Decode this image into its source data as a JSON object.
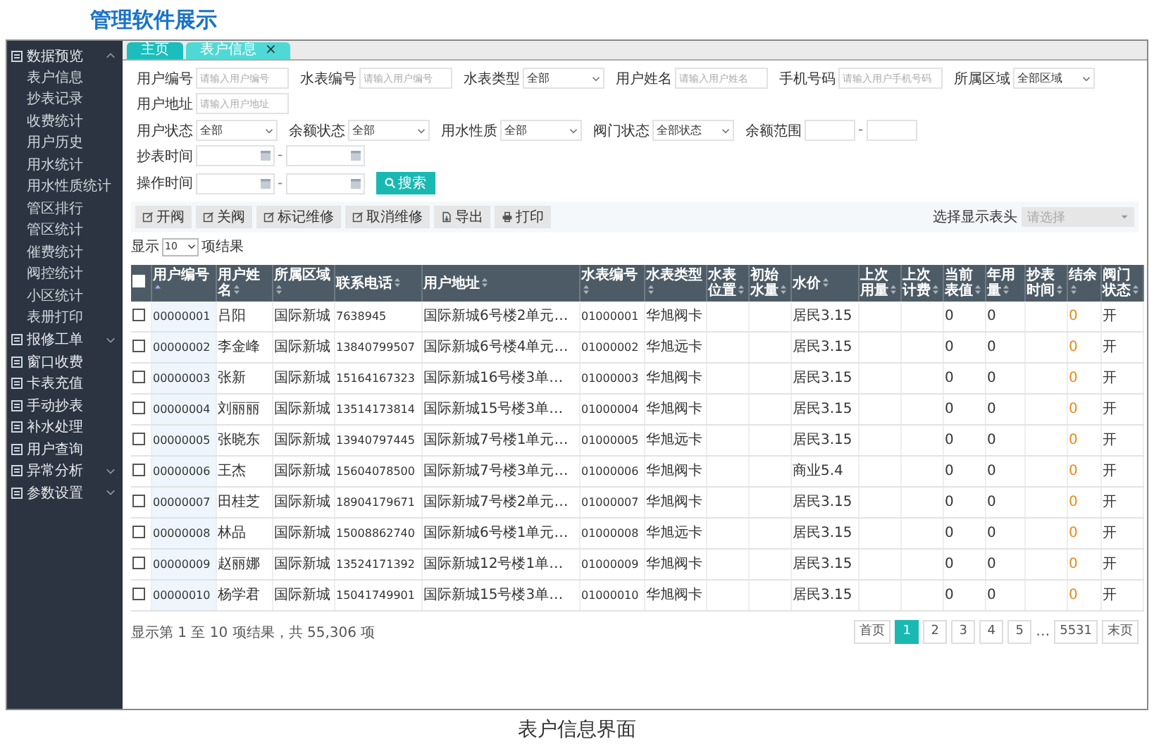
{
  "page": {
    "title": "管理软件展示",
    "caption": "表户信息界面"
  },
  "sidebar": {
    "items": [
      {
        "label": "数据预览",
        "expanded": true,
        "children": [
          {
            "label": "表户信息"
          },
          {
            "label": "抄表记录"
          },
          {
            "label": "收费统计"
          },
          {
            "label": "用户历史"
          },
          {
            "label": "用水统计"
          },
          {
            "label": "用水性质统计"
          },
          {
            "label": "管区排行"
          },
          {
            "label": "管区统计"
          },
          {
            "label": "催费统计"
          },
          {
            "label": "阀控统计"
          },
          {
            "label": "小区统计"
          },
          {
            "label": "表册打印"
          }
        ]
      },
      {
        "label": "报修工单",
        "expanded": false
      },
      {
        "label": "窗口收费"
      },
      {
        "label": "卡表充值"
      },
      {
        "label": "手动抄表"
      },
      {
        "label": "补水处理"
      },
      {
        "label": "用户查询"
      },
      {
        "label": "异常分析",
        "expanded": false
      },
      {
        "label": "参数设置",
        "expanded": false
      }
    ]
  },
  "tabs": [
    {
      "label": "主页",
      "selected": false
    },
    {
      "label": "表户信息",
      "selected": true,
      "close": "×"
    }
  ],
  "filter_rows": [
    [
      {
        "label": "用户编号",
        "kind": "text",
        "placeholder": "请输入用户编号"
      },
      {
        "label": "水表编号",
        "kind": "text",
        "placeholder": "请输入用户编号"
      },
      {
        "label": "水表类型",
        "kind": "select",
        "value": "全部"
      },
      {
        "label": "用户姓名",
        "kind": "text",
        "placeholder": "请输入用户姓名"
      },
      {
        "label": "手机号码",
        "kind": "text",
        "placeholder": "请输入用户手机号码"
      },
      {
        "label": "所属区域",
        "kind": "select",
        "value": "全部区域"
      },
      {
        "label": "用户地址",
        "kind": "text",
        "placeholder": "请输入用户地址"
      }
    ],
    [
      {
        "label": "用户状态",
        "kind": "select",
        "value": "全部"
      },
      {
        "label": "余额状态",
        "kind": "select",
        "value": "全部"
      },
      {
        "label": "用水性质",
        "kind": "select",
        "value": "全部"
      },
      {
        "label": "阀门状态",
        "kind": "select",
        "value": "全部状态"
      },
      {
        "label": "余额范围",
        "kind": "range",
        "separator": "-"
      },
      {
        "label": "抄表时间",
        "kind": "date_range",
        "separator": "-"
      }
    ],
    [
      {
        "label": "操作时间",
        "kind": "date_range",
        "separator": "-"
      }
    ]
  ],
  "search_button": "搜索",
  "toolbar": [
    {
      "label": "开阀",
      "kind": "edit"
    },
    {
      "label": "关阀",
      "kind": "edit"
    },
    {
      "label": "标记维修",
      "kind": "edit"
    },
    {
      "label": "取消维修",
      "kind": "edit"
    },
    {
      "label": "导出",
      "kind": "export"
    },
    {
      "label": "打印",
      "kind": "print"
    }
  ],
  "column_picker": {
    "label": "选择显示表头",
    "placeholder": "请选择"
  },
  "page_size": {
    "prefix": "显示",
    "value": "10",
    "suffix": "项结果"
  },
  "table": {
    "all_checked": false,
    "columns": [
      "用户编号",
      "用户姓名",
      "所属区域",
      "联系电话",
      "用户地址",
      "水表编号",
      "水表类型",
      "水表位置",
      "初始水量",
      "水价",
      "上次用量",
      "上次计费",
      "当前表值",
      "年用量",
      "抄表时间",
      "结余",
      "阀门状态"
    ],
    "rows": [
      {
        "checked": false,
        "cells": [
          "00000001",
          "吕阳",
          "国际新城",
          "7638945",
          "国际新城6号楼2单元…",
          "01000001",
          "华旭阀卡",
          "",
          "",
          "居民3.15",
          "",
          "",
          "0",
          "0",
          "",
          "0",
          "开"
        ]
      },
      {
        "checked": false,
        "cells": [
          "00000002",
          "李金峰",
          "国际新城",
          "13840799507",
          "国际新城6号楼4单元…",
          "01000002",
          "华旭远卡",
          "",
          "",
          "居民3.15",
          "",
          "",
          "0",
          "0",
          "",
          "0",
          "开"
        ]
      },
      {
        "checked": false,
        "cells": [
          "00000003",
          "张新",
          "国际新城",
          "15164167323",
          "国际新城16号楼3单…",
          "01000003",
          "华旭阀卡",
          "",
          "",
          "居民3.15",
          "",
          "",
          "0",
          "0",
          "",
          "0",
          "开"
        ]
      },
      {
        "checked": false,
        "cells": [
          "00000004",
          "刘丽丽",
          "国际新城",
          "13514173814",
          "国际新城15号楼3单…",
          "01000004",
          "华旭阀卡",
          "",
          "",
          "居民3.15",
          "",
          "",
          "0",
          "0",
          "",
          "0",
          "开"
        ]
      },
      {
        "checked": false,
        "cells": [
          "00000005",
          "张晓东",
          "国际新城",
          "13940797445",
          "国际新城7号楼1单元…",
          "01000005",
          "华旭远卡",
          "",
          "",
          "居民3.15",
          "",
          "",
          "0",
          "0",
          "",
          "0",
          "开"
        ]
      },
      {
        "checked": false,
        "cells": [
          "00000006",
          "王杰",
          "国际新城",
          "15604078500",
          "国际新城7号楼3单元…",
          "01000006",
          "华旭阀卡",
          "",
          "",
          "商业5.4",
          "",
          "",
          "0",
          "0",
          "",
          "0",
          "开"
        ]
      },
      {
        "checked": false,
        "cells": [
          "00000007",
          "田桂芝",
          "国际新城",
          "18904179671",
          "国际新城7号楼2单元…",
          "01000007",
          "华旭阀卡",
          "",
          "",
          "居民3.15",
          "",
          "",
          "0",
          "0",
          "",
          "0",
          "开"
        ]
      },
      {
        "checked": false,
        "cells": [
          "00000008",
          "林品",
          "国际新城",
          "15008862740",
          "国际新城6号楼1单元…",
          "01000008",
          "华旭远卡",
          "",
          "",
          "居民3.15",
          "",
          "",
          "0",
          "0",
          "",
          "0",
          "开"
        ]
      },
      {
        "checked": false,
        "cells": [
          "00000009",
          "赵丽娜",
          "国际新城",
          "13524171392",
          "国际新城12号楼1单…",
          "01000009",
          "华旭阀卡",
          "",
          "",
          "居民3.15",
          "",
          "",
          "0",
          "0",
          "",
          "0",
          "开"
        ]
      },
      {
        "checked": false,
        "cells": [
          "00000010",
          "杨学君",
          "国际新城",
          "15041749901",
          "国际新城15号楼3单…",
          "01000010",
          "华旭阀卡",
          "",
          "",
          "居民3.15",
          "",
          "",
          "0",
          "0",
          "",
          "0",
          "开"
        ]
      }
    ]
  },
  "footer": {
    "summary": "显示第 1 至 10 项结果，共 55,306 项",
    "pages": [
      {
        "label": "首页",
        "kind": "page",
        "selected": false
      },
      {
        "label": "1",
        "kind": "page",
        "selected": true
      },
      {
        "label": "2",
        "kind": "page",
        "selected": false
      },
      {
        "label": "3",
        "kind": "page",
        "selected": false
      },
      {
        "label": "4",
        "kind": "page",
        "selected": false
      },
      {
        "label": "5",
        "kind": "page",
        "selected": false
      },
      {
        "label": "…",
        "kind": "gap"
      },
      {
        "label": "5531",
        "kind": "page",
        "selected": false
      },
      {
        "label": "末页",
        "kind": "page",
        "selected": false
      }
    ]
  }
}
